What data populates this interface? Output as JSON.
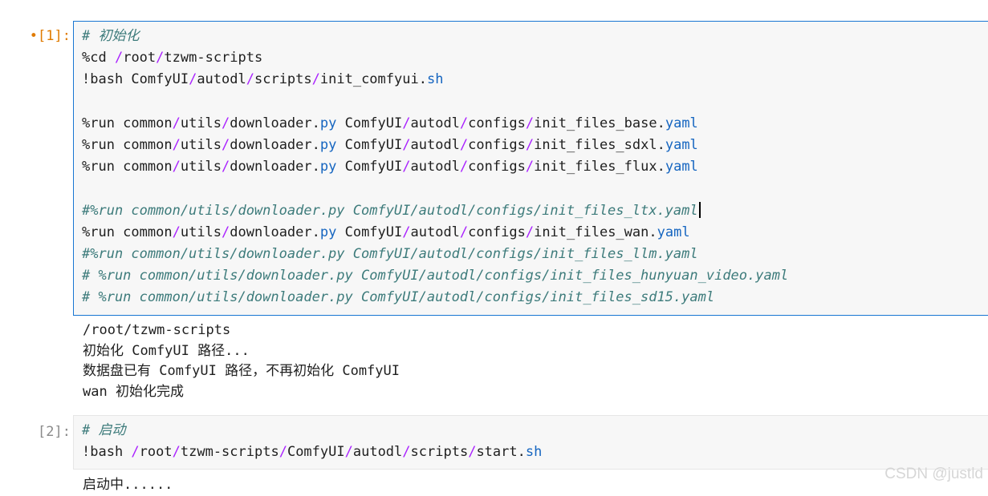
{
  "cells": [
    {
      "prompt_marker": "•",
      "prompt_label": "[1]:",
      "lines": [
        {
          "type": "comment",
          "text": "# 初始化"
        },
        {
          "type": "code",
          "parts": [
            {
              "t": "kw",
              "s": "%cd "
            },
            {
              "t": "op",
              "s": "/"
            },
            {
              "t": "kw",
              "s": "root"
            },
            {
              "t": "op",
              "s": "/"
            },
            {
              "t": "kw",
              "s": "tzwm-scripts"
            }
          ]
        },
        {
          "type": "code",
          "parts": [
            {
              "t": "kw",
              "s": "!bash ComfyUI"
            },
            {
              "t": "op",
              "s": "/"
            },
            {
              "t": "kw",
              "s": "autodl"
            },
            {
              "t": "op",
              "s": "/"
            },
            {
              "t": "kw",
              "s": "scripts"
            },
            {
              "t": "op",
              "s": "/"
            },
            {
              "t": "kw",
              "s": "init_comfyui."
            },
            {
              "t": "ext",
              "s": "sh"
            }
          ]
        },
        {
          "type": "blank"
        },
        {
          "type": "code",
          "parts": [
            {
              "t": "kw",
              "s": "%run common"
            },
            {
              "t": "op",
              "s": "/"
            },
            {
              "t": "kw",
              "s": "utils"
            },
            {
              "t": "op",
              "s": "/"
            },
            {
              "t": "kw",
              "s": "downloader."
            },
            {
              "t": "ext",
              "s": "py"
            },
            {
              "t": "kw",
              "s": " ComfyUI"
            },
            {
              "t": "op",
              "s": "/"
            },
            {
              "t": "kw",
              "s": "autodl"
            },
            {
              "t": "op",
              "s": "/"
            },
            {
              "t": "kw",
              "s": "configs"
            },
            {
              "t": "op",
              "s": "/"
            },
            {
              "t": "kw",
              "s": "init_files_base."
            },
            {
              "t": "ext",
              "s": "yaml"
            }
          ]
        },
        {
          "type": "code",
          "parts": [
            {
              "t": "kw",
              "s": "%run common"
            },
            {
              "t": "op",
              "s": "/"
            },
            {
              "t": "kw",
              "s": "utils"
            },
            {
              "t": "op",
              "s": "/"
            },
            {
              "t": "kw",
              "s": "downloader."
            },
            {
              "t": "ext",
              "s": "py"
            },
            {
              "t": "kw",
              "s": " ComfyUI"
            },
            {
              "t": "op",
              "s": "/"
            },
            {
              "t": "kw",
              "s": "autodl"
            },
            {
              "t": "op",
              "s": "/"
            },
            {
              "t": "kw",
              "s": "configs"
            },
            {
              "t": "op",
              "s": "/"
            },
            {
              "t": "kw",
              "s": "init_files_sdxl."
            },
            {
              "t": "ext",
              "s": "yaml"
            }
          ]
        },
        {
          "type": "code",
          "parts": [
            {
              "t": "kw",
              "s": "%run common"
            },
            {
              "t": "op",
              "s": "/"
            },
            {
              "t": "kw",
              "s": "utils"
            },
            {
              "t": "op",
              "s": "/"
            },
            {
              "t": "kw",
              "s": "downloader."
            },
            {
              "t": "ext",
              "s": "py"
            },
            {
              "t": "kw",
              "s": " ComfyUI"
            },
            {
              "t": "op",
              "s": "/"
            },
            {
              "t": "kw",
              "s": "autodl"
            },
            {
              "t": "op",
              "s": "/"
            },
            {
              "t": "kw",
              "s": "configs"
            },
            {
              "t": "op",
              "s": "/"
            },
            {
              "t": "kw",
              "s": "init_files_flux."
            },
            {
              "t": "ext",
              "s": "yaml"
            }
          ]
        },
        {
          "type": "blank"
        },
        {
          "type": "comment",
          "text": "#%run common/utils/downloader.py ComfyUI/autodl/configs/init_files_ltx.yaml",
          "cursor": true
        },
        {
          "type": "code",
          "parts": [
            {
              "t": "kw",
              "s": "%run common"
            },
            {
              "t": "op",
              "s": "/"
            },
            {
              "t": "kw",
              "s": "utils"
            },
            {
              "t": "op",
              "s": "/"
            },
            {
              "t": "kw",
              "s": "downloader."
            },
            {
              "t": "ext",
              "s": "py"
            },
            {
              "t": "kw",
              "s": " ComfyUI"
            },
            {
              "t": "op",
              "s": "/"
            },
            {
              "t": "kw",
              "s": "autodl"
            },
            {
              "t": "op",
              "s": "/"
            },
            {
              "t": "kw",
              "s": "configs"
            },
            {
              "t": "op",
              "s": "/"
            },
            {
              "t": "kw",
              "s": "init_files_wan."
            },
            {
              "t": "ext",
              "s": "yaml"
            }
          ]
        },
        {
          "type": "comment",
          "text": "#%run common/utils/downloader.py ComfyUI/autodl/configs/init_files_llm.yaml"
        },
        {
          "type": "comment",
          "text": "# %run common/utils/downloader.py ComfyUI/autodl/configs/init_files_hunyuan_video.yaml"
        },
        {
          "type": "comment",
          "text": "# %run common/utils/downloader.py ComfyUI/autodl/configs/init_files_sd15.yaml"
        }
      ],
      "output": [
        "/root/tzwm-scripts",
        "初始化 ComfyUI 路径...",
        "数据盘已有 ComfyUI 路径，不再初始化 ComfyUI",
        "wan 初始化完成"
      ]
    },
    {
      "prompt_label": "[2]:",
      "lines": [
        {
          "type": "comment",
          "text": "# 启动"
        },
        {
          "type": "code",
          "parts": [
            {
              "t": "kw",
              "s": "!bash "
            },
            {
              "t": "op",
              "s": "/"
            },
            {
              "t": "kw",
              "s": "root"
            },
            {
              "t": "op",
              "s": "/"
            },
            {
              "t": "kw",
              "s": "tzwm-scripts"
            },
            {
              "t": "op",
              "s": "/"
            },
            {
              "t": "kw",
              "s": "ComfyUI"
            },
            {
              "t": "op",
              "s": "/"
            },
            {
              "t": "kw",
              "s": "autodl"
            },
            {
              "t": "op",
              "s": "/"
            },
            {
              "t": "kw",
              "s": "scripts"
            },
            {
              "t": "op",
              "s": "/"
            },
            {
              "t": "kw",
              "s": "start."
            },
            {
              "t": "ext",
              "s": "sh"
            }
          ]
        }
      ],
      "output": [
        "启动中......"
      ]
    }
  ],
  "watermark": "CSDN @justld",
  "colors": {
    "prompt_active": "#e07b00",
    "prompt_idle": "#8a8a8a",
    "selected_border": "#1976d2",
    "comment": "#3d7b7b",
    "operator": "#aa22ff",
    "extension": "#1565c0"
  }
}
